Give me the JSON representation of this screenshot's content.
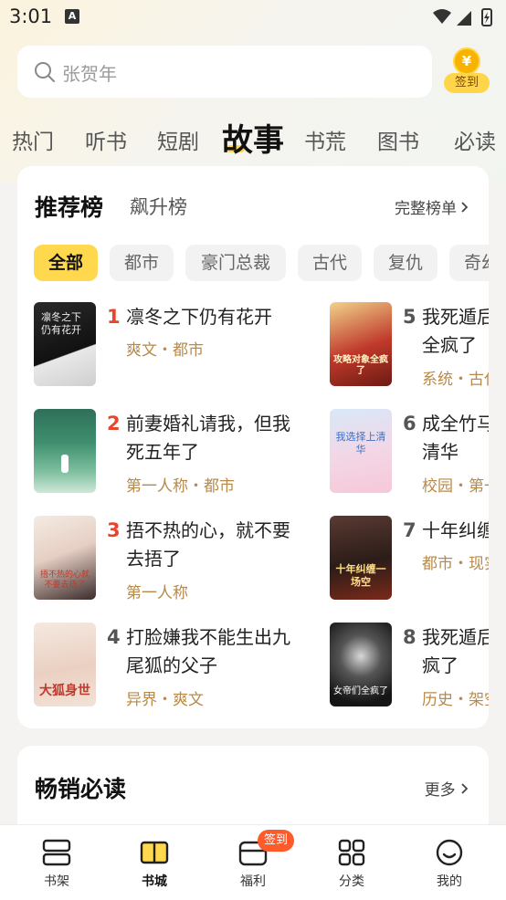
{
  "status_bar": {
    "time": "3:01",
    "notif_icon": "A"
  },
  "search": {
    "placeholder": "张贺年"
  },
  "checkin": {
    "label": "签到",
    "coin_symbol": "¥"
  },
  "category_tabs": [
    "热门",
    "听书",
    "短剧",
    "故事",
    "书荒",
    "图书",
    "必读"
  ],
  "active_tab": "故事",
  "ranking": {
    "title": "推荐榜",
    "alt_title": "飙升榜",
    "full_list": "完整榜单",
    "chips": [
      "全部",
      "都市",
      "豪门总裁",
      "古代",
      "复仇",
      "奇幻"
    ],
    "books": [
      {
        "rank": "1",
        "title": "凛冬之下仍有花开",
        "tags": "爽文・都市",
        "cover_text": "凛冬之下仍有花开"
      },
      {
        "rank": "2",
        "title": "前妻婚礼请我，但我死五年了",
        "tags": "第一人称・都市",
        "cover_text": ""
      },
      {
        "rank": "3",
        "title": "捂不热的心，就不要去捂了",
        "tags": "第一人称",
        "cover_text": "捂不热的心就不要去捂了"
      },
      {
        "rank": "4",
        "title": "打脸嫌我不能生出九尾狐的父子",
        "tags": "异界・爽文",
        "cover_text": "大狐身世"
      },
      {
        "rank": "5",
        "title": "我死遁后，攻略对象全疯了",
        "tags": "系统・古代",
        "cover_text": "攻略对象全疯了"
      },
      {
        "rank": "6",
        "title": "成全竹马，我选择上清华",
        "tags": "校园・第一人称",
        "cover_text": "我选择上清华"
      },
      {
        "rank": "7",
        "title": "十年纠缠一场空",
        "tags": "都市・现实",
        "cover_text": "十年纠缠一场空"
      },
      {
        "rank": "8",
        "title": "我死遁后，公主们全疯了",
        "tags": "历史・架空",
        "cover_text": "女帝们全疯了"
      }
    ]
  },
  "bestseller": {
    "title": "畅销必读",
    "more": "更多"
  },
  "bottom_nav": [
    {
      "label": "书架",
      "icon": "bookshelf-icon"
    },
    {
      "label": "书城",
      "icon": "open-book-icon"
    },
    {
      "label": "福利",
      "icon": "gift-box-icon",
      "badge": "签到"
    },
    {
      "label": "分类",
      "icon": "grid-icon"
    },
    {
      "label": "我的",
      "icon": "smile-face-icon"
    }
  ],
  "colors": {
    "accent": "#ffd84d",
    "rank_top": "#e8452c",
    "rank_other": "#555555",
    "tag": "#b88a4a",
    "badge": "#ff5a2a"
  }
}
